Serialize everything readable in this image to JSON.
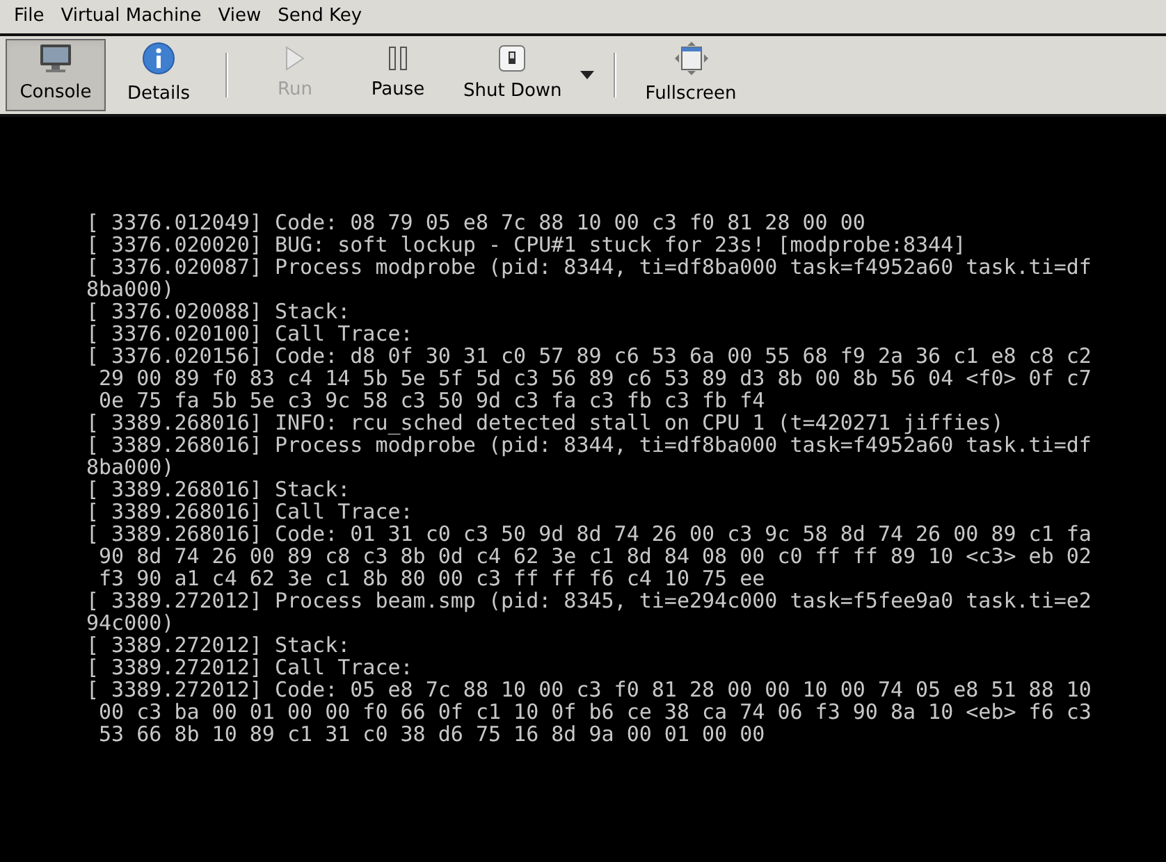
{
  "menu": [
    "File",
    "Virtual Machine",
    "View",
    "Send Key"
  ],
  "toolbar": [
    {
      "kind": "button",
      "label": "Console",
      "selected": true,
      "disabled": false
    },
    {
      "kind": "button",
      "label": "Details",
      "selected": false,
      "disabled": false
    },
    {
      "kind": "separator"
    },
    {
      "kind": "button",
      "label": "Run",
      "selected": false,
      "disabled": true
    },
    {
      "kind": "button",
      "label": "Pause",
      "selected": false,
      "disabled": false
    },
    {
      "kind": "button",
      "label": "Shut Down",
      "selected": false,
      "disabled": false
    },
    {
      "kind": "dropdown"
    },
    {
      "kind": "separator"
    },
    {
      "kind": "button",
      "label": "Fullscreen",
      "selected": false,
      "disabled": false
    }
  ],
  "console": {
    "lines": [
      "[ 3376.012049] Code: 08 79 05 e8 7c 88 10 00 c3 f0 81 28 00 00",
      "[ 3376.020020] BUG: soft lockup - CPU#1 stuck for 23s! [modprobe:8344]",
      "[ 3376.020087] Process modprobe (pid: 8344, ti=df8ba000 task=f4952a60 task.ti=df",
      "8ba000)",
      "[ 3376.020088] Stack:",
      "[ 3376.020100] Call Trace:",
      "[ 3376.020156] Code: d8 0f 30 31 c0 57 89 c6 53 6a 00 55 68 f9 2a 36 c1 e8 c8 c2",
      " 29 00 89 f0 83 c4 14 5b 5e 5f 5d c3 56 89 c6 53 89 d3 8b 00 8b 56 04 <f0> 0f c7",
      " 0e 75 fa 5b 5e c3 9c 58 c3 50 9d c3 fa c3 fb c3 fb f4",
      "[ 3389.268016] INFO: rcu_sched detected stall on CPU 1 (t=420271 jiffies)",
      "[ 3389.268016] Process modprobe (pid: 8344, ti=df8ba000 task=f4952a60 task.ti=df",
      "8ba000)",
      "[ 3389.268016] Stack:",
      "[ 3389.268016] Call Trace:",
      "[ 3389.268016] Code: 01 31 c0 c3 50 9d 8d 74 26 00 c3 9c 58 8d 74 26 00 89 c1 fa",
      " 90 8d 74 26 00 89 c8 c3 8b 0d c4 62 3e c1 8d 84 08 00 c0 ff ff 89 10 <c3> eb 02",
      " f3 90 a1 c4 62 3e c1 8b 80 00 c3 ff ff f6 c4 10 75 ee",
      "[ 3389.272012] Process beam.smp (pid: 8345, ti=e294c000 task=f5fee9a0 task.ti=e2",
      "94c000)",
      "[ 3389.272012] Stack:",
      "[ 3389.272012] Call Trace:",
      "[ 3389.272012] Code: 05 e8 7c 88 10 00 c3 f0 81 28 00 00 10 00 74 05 e8 51 88 10",
      " 00 c3 ba 00 01 00 00 f0 66 0f c1 10 0f b6 ce 38 ca 74 06 f3 90 8a 10 <eb> f6 c3",
      " 53 66 8b 10 89 c1 31 c0 38 d6 75 16 8d 9a 00 01 00 00"
    ]
  }
}
